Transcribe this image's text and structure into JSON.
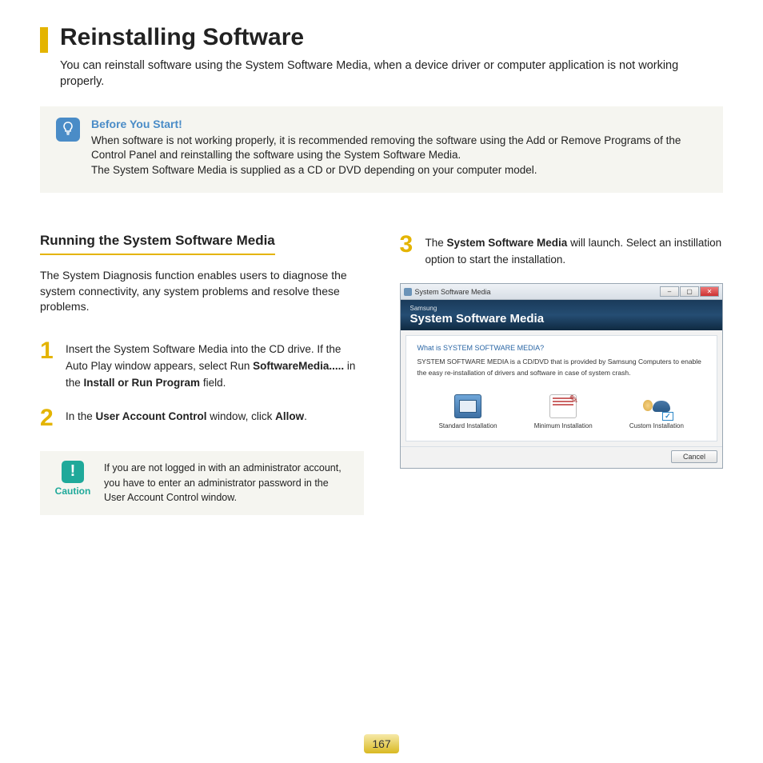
{
  "page_title": "Reinstalling Software",
  "intro": "You can reinstall software using the System Software Media, when a device driver or computer application is not working properly.",
  "tip": {
    "title": "Before You Start!",
    "text": "When software is not working properly, it is recommended removing the software using the Add or Remove Programs of the Control Panel and reinstalling the software using the System Software Media.\nThe System Software Media is supplied as a CD or DVD depending on your computer model."
  },
  "section_title": "Running the System Software Media",
  "section_desc": "The System Diagnosis function enables users to diagnose the system connectivity, any system problems and resolve these problems.",
  "steps": {
    "s1_number": "1",
    "s1_a": "Insert the System Software Media into the CD drive. If the Auto Play window appears, select Run ",
    "s1_b": "SoftwareMedia.....",
    "s1_c": " in the ",
    "s1_d": "Install or Run Program",
    "s1_e": " field.",
    "s2_number": "2",
    "s2_a": "In the ",
    "s2_b": "User Account Control",
    "s2_c": " window, click ",
    "s2_d": "Allow",
    "s2_e": ".",
    "s3_number": "3",
    "s3_a": "The ",
    "s3_b": "System Software Media",
    "s3_c": " will launch. Select an instillation option to start the installation."
  },
  "caution": {
    "label": "Caution",
    "text": "If you are not logged in with an administrator account, you have to enter an administrator password in the User Account Control window."
  },
  "ssm_window": {
    "titlebar": "System Software Media",
    "banner_sub": "Samsung",
    "banner_main": "System Software Media",
    "question": "What is SYSTEM SOFTWARE MEDIA?",
    "desc": "SYSTEM SOFTWARE MEDIA is a CD/DVD that is provided by Samsung Computers to enable the easy re-installation of drivers and software in case of system crash.",
    "options": [
      "Standard Installation",
      "Minimum Installation",
      "Custom Installation"
    ],
    "cancel": "Cancel"
  },
  "page_number": "167"
}
